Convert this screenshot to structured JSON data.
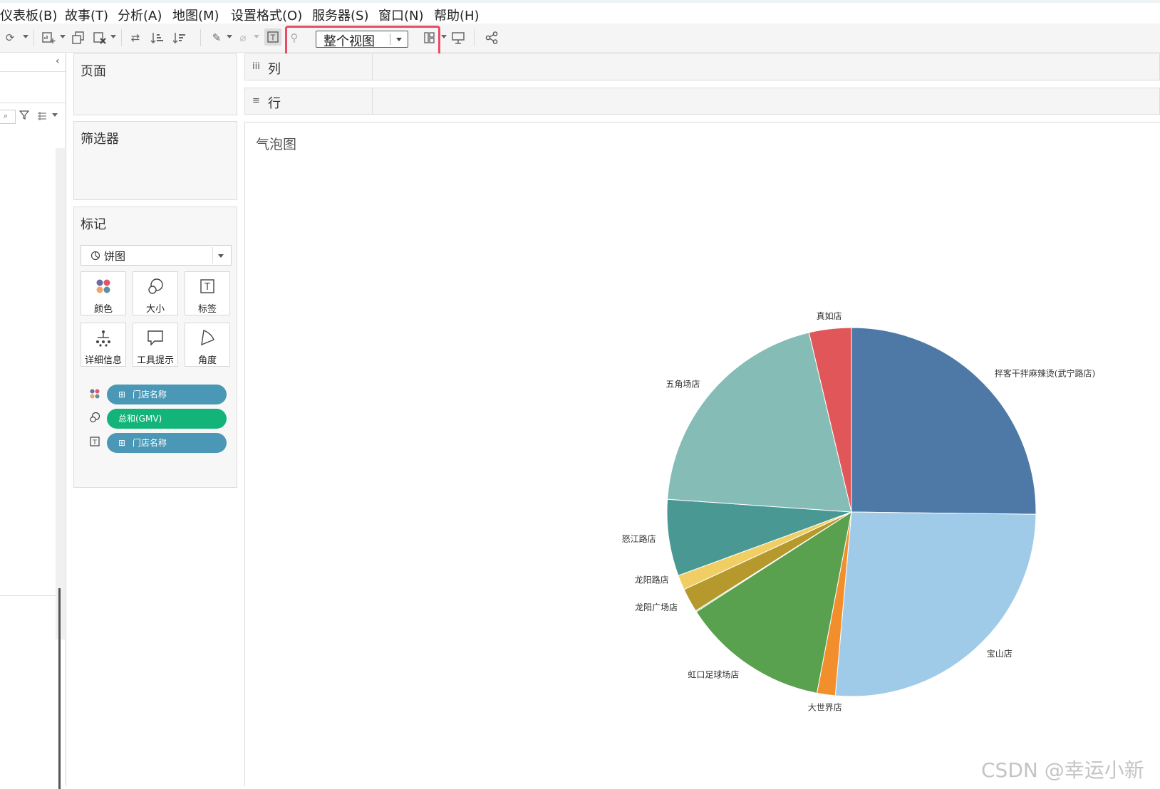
{
  "menu": {
    "items": [
      "仪表板(B)",
      "故事(T)",
      "分析(A)",
      "地图(M)",
      "设置格式(O)",
      "服务器(S)",
      "窗口(N)",
      "帮助(H)"
    ]
  },
  "toolbar": {
    "fit_value": "整个视图",
    "highlight_color": "#e84d68"
  },
  "shelves": {
    "pages_label": "页面",
    "filters_label": "筛选器",
    "columns_label": "列",
    "rows_label": "行"
  },
  "marks": {
    "title": "标记",
    "type_value": "饼图",
    "buttons": [
      "颜色",
      "大小",
      "标签",
      "详细信息",
      "工具提示",
      "角度"
    ],
    "pills": [
      {
        "text": "门店名称",
        "encoding": "color",
        "color": "#4a97b6",
        "prefix": "⊞"
      },
      {
        "text": "总和(GMV)",
        "encoding": "size",
        "color": "#12b47a",
        "prefix": ""
      },
      {
        "text": "门店名称",
        "encoding": "label",
        "color": "#4a97b6",
        "prefix": "⊞"
      }
    ]
  },
  "view": {
    "sheet_title": "气泡图"
  },
  "watermark": "CSDN @幸运小新",
  "chart_data": {
    "type": "pie",
    "title": "",
    "slices": [
      {
        "label": "拌客干拌麻辣烫(武宁路店)",
        "value": 25.2,
        "color": "#4e79a7"
      },
      {
        "label": "宝山店",
        "value": 26.2,
        "color": "#a0cbe8"
      },
      {
        "label": "大世界店",
        "value": 1.6,
        "color": "#f28e2b"
      },
      {
        "label": "虹口足球场店",
        "value": 12.9,
        "color": "#59a14f"
      },
      {
        "label": "龙阳广场店",
        "value": 0.1,
        "color": "#8cd17d"
      },
      {
        "label": "龙阳广场店",
        "value": 2.1,
        "color": "#b6992d"
      },
      {
        "label": "龙阳路店",
        "value": 1.3,
        "color": "#f1ce63"
      },
      {
        "label": "怒江路店",
        "value": 6.7,
        "color": "#499894"
      },
      {
        "label": "五角场店",
        "value": 20.2,
        "color": "#86bcb6"
      },
      {
        "label": "真如店",
        "value": 3.7,
        "color": "#e15759"
      }
    ],
    "visible_labels": [
      {
        "text": "拌客干拌麻辣烫(武宁路店)",
        "slice": 0,
        "anchor": "start"
      },
      {
        "text": "宝山店",
        "slice": 1,
        "anchor": "start"
      },
      {
        "text": "大世界店",
        "slice": 2,
        "anchor": "middle"
      },
      {
        "text": "虹口足球场店",
        "slice": 3,
        "anchor": "end"
      },
      {
        "text": "龙阳广场店",
        "slice": 5,
        "anchor": "end"
      },
      {
        "text": "龙阳路店",
        "slice": 6,
        "anchor": "end"
      },
      {
        "text": "怒江路店",
        "slice": 7,
        "anchor": "end"
      },
      {
        "text": "五角场店",
        "slice": 8,
        "anchor": "end"
      },
      {
        "text": "真如店",
        "slice": 9,
        "anchor": "middle"
      }
    ],
    "start": "12 o'clock, clockwise"
  }
}
